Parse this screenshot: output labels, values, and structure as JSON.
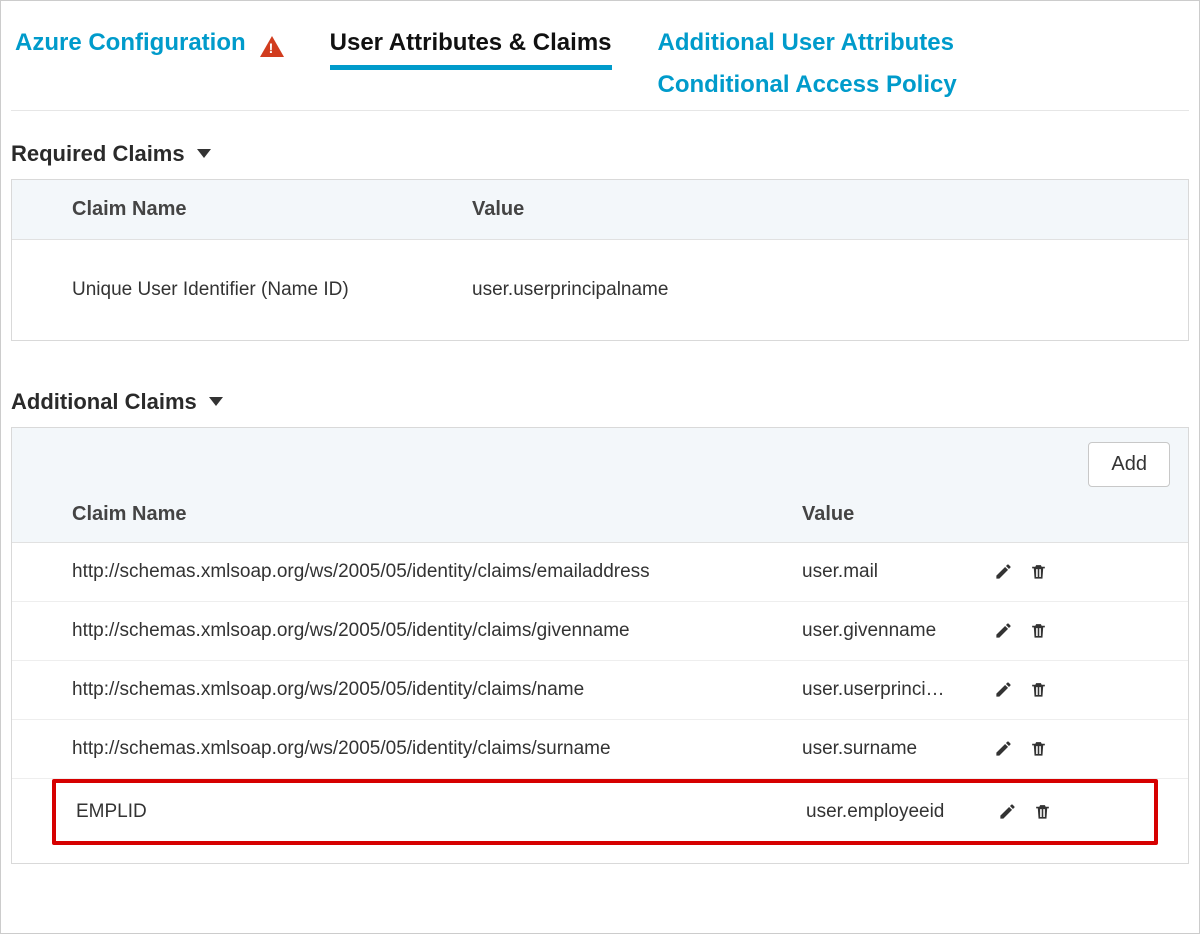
{
  "tabs": {
    "azure": "Azure Configuration",
    "attrs": "User Attributes & Claims",
    "additional_attrs": "Additional User Attributes",
    "policy": "Conditional Access Policy"
  },
  "sections": {
    "required_title": "Required Claims",
    "additional_title": "Additional Claims"
  },
  "headers": {
    "claim_name": "Claim Name",
    "value": "Value"
  },
  "required_claims": [
    {
      "name": "Unique User Identifier (Name ID)",
      "value": "user.userprincipalname"
    }
  ],
  "add_button": "Add",
  "additional_claims": [
    {
      "name": "http://schemas.xmlsoap.org/ws/2005/05/identity/claims/emailaddress",
      "value": "user.mail"
    },
    {
      "name": "http://schemas.xmlsoap.org/ws/2005/05/identity/claims/givenname",
      "value": "user.givenname"
    },
    {
      "name": "http://schemas.xmlsoap.org/ws/2005/05/identity/claims/name",
      "value": "user.userprinci…"
    },
    {
      "name": "http://schemas.xmlsoap.org/ws/2005/05/identity/claims/surname",
      "value": "user.surname"
    },
    {
      "name": "EMPLID",
      "value": "user.employeeid"
    }
  ]
}
